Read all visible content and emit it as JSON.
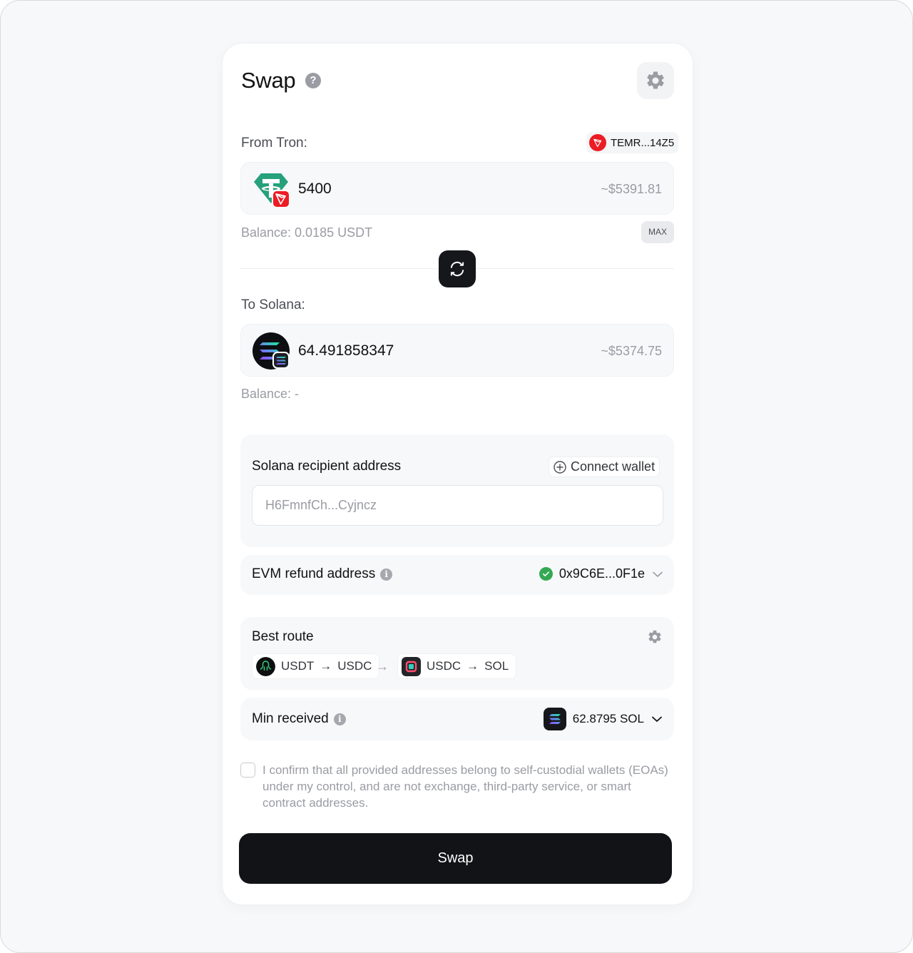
{
  "header": {
    "title": "Swap"
  },
  "from": {
    "label": "From Tron:",
    "address": "TEMR...14Z5",
    "amount": "5400",
    "usd_value": "~$5391.81",
    "balance": "Balance: 0.0185 USDT",
    "max_label": "MAX",
    "token_icon": "usdt-icon",
    "chain_icon": "tron-icon"
  },
  "to": {
    "label": "To Solana:",
    "amount": "64.491858347",
    "usd_value": "~$5374.75",
    "balance": "Balance: -",
    "token_icon": "sol-icon",
    "chain_icon": "solana-icon"
  },
  "recipient": {
    "title": "Solana recipient address",
    "connect_label": "Connect wallet",
    "placeholder": "H6FmnfCh...Cyjncz"
  },
  "refund": {
    "title": "EVM refund address",
    "address": "0x9C6E...0F1e"
  },
  "route": {
    "title": "Best route",
    "steps": [
      {
        "from": "USDT",
        "to": "USDC"
      },
      {
        "from": "USDC",
        "to": "SOL"
      }
    ],
    "arrow": "→"
  },
  "min_received": {
    "title": "Min received",
    "value": "62.8795 SOL"
  },
  "confirm": {
    "text": "I confirm that all provided addresses belong to self-custodial wallets (EOAs) under my control, and are not exchange, third-party service, or smart contract addresses."
  },
  "swap_button": {
    "label": "Swap"
  },
  "colors": {
    "tron_red": "#ec1c24",
    "usdt_green": "#26a17b",
    "success_green": "#34a853",
    "button_dark": "#121316"
  }
}
